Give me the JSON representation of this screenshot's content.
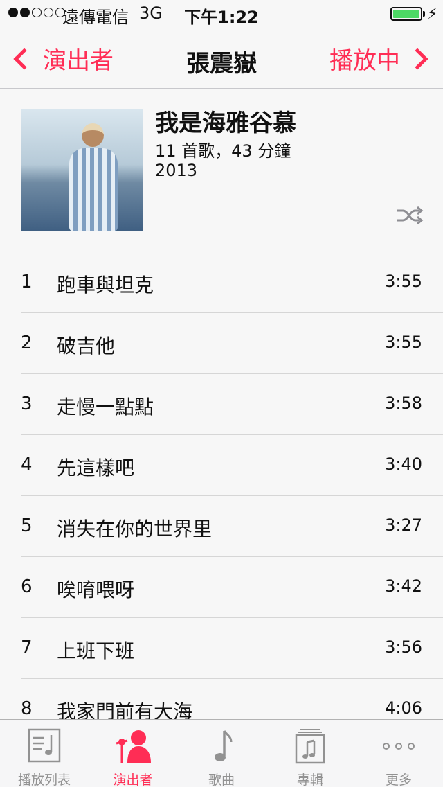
{
  "status_bar": {
    "carrier": "遠傳電信",
    "network": "3G",
    "time": "下午1:22",
    "battery_color": "#4cd964",
    "signal_bars_filled": 2,
    "signal_bars_total": 5
  },
  "nav": {
    "back_label": "演出者",
    "title": "張震嶽",
    "forward_label": "播放中",
    "accent_color": "#ff2d55"
  },
  "album": {
    "title": "我是海雅谷慕",
    "meta": "11 首歌，43 分鐘",
    "year": "2013",
    "shuffle_icon": "shuffle-icon"
  },
  "tracks": [
    {
      "number": "1",
      "title": "跑車與坦克",
      "duration": "3:55"
    },
    {
      "number": "2",
      "title": "破吉他",
      "duration": "3:55"
    },
    {
      "number": "3",
      "title": "走慢一點點",
      "duration": "3:58"
    },
    {
      "number": "4",
      "title": "先這樣吧",
      "duration": "3:40"
    },
    {
      "number": "5",
      "title": "消失在你的世界里",
      "duration": "3:27"
    },
    {
      "number": "6",
      "title": "唉唷喂呀",
      "duration": "3:42"
    },
    {
      "number": "7",
      "title": "上班下班",
      "duration": "3:56"
    },
    {
      "number": "8",
      "title": "我家門前有大海",
      "duration": "4:06"
    }
  ],
  "tab_bar": {
    "items": [
      {
        "label": "播放列表",
        "icon": "playlist-icon",
        "active": false
      },
      {
        "label": "演出者",
        "icon": "artist-icon",
        "active": true
      },
      {
        "label": "歌曲",
        "icon": "song-note-icon",
        "active": false
      },
      {
        "label": "專輯",
        "icon": "album-icon",
        "active": false
      },
      {
        "label": "更多",
        "icon": "more-icon",
        "active": false
      }
    ]
  }
}
